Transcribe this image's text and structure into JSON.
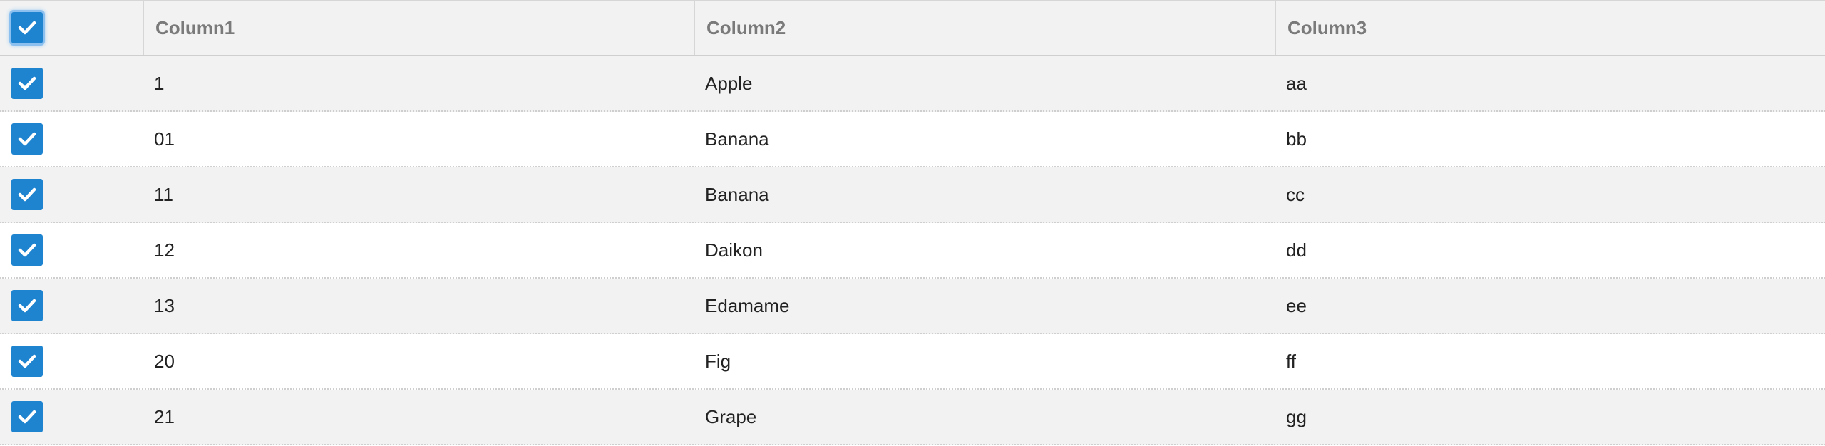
{
  "accent_color": "#1f84cf",
  "header": {
    "select_all_icon": "checkmark-icon",
    "select_all_checked": true,
    "columns": [
      "Column1",
      "Column2",
      "Column3"
    ]
  },
  "rows": [
    {
      "checked": true,
      "col1": "1",
      "col2": "Apple",
      "col3": "aa"
    },
    {
      "checked": true,
      "col1": "01",
      "col2": "Banana",
      "col3": "bb"
    },
    {
      "checked": true,
      "col1": "11",
      "col2": "Banana",
      "col3": "cc"
    },
    {
      "checked": true,
      "col1": "12",
      "col2": "Daikon",
      "col3": "dd"
    },
    {
      "checked": true,
      "col1": "13",
      "col2": "Edamame",
      "col3": "ee"
    },
    {
      "checked": true,
      "col1": "20",
      "col2": "Fig",
      "col3": "ff"
    },
    {
      "checked": true,
      "col1": "21",
      "col2": "Grape",
      "col3": "gg"
    }
  ]
}
